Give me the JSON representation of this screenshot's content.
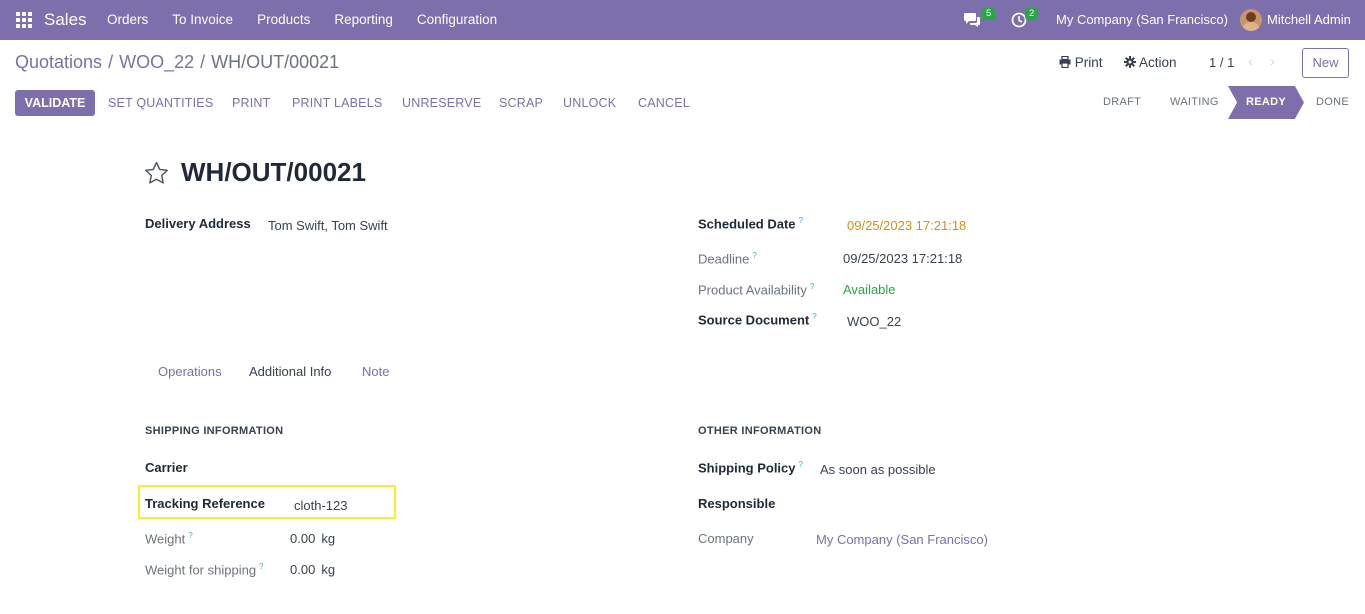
{
  "navbar": {
    "brand": "Sales",
    "menu": [
      "Orders",
      "To Invoice",
      "Products",
      "Reporting",
      "Configuration"
    ],
    "messages_count": "5",
    "activities_count": "2",
    "company": "My Company (San Francisco)",
    "user": "Mitchell Admin"
  },
  "breadcrumb": {
    "items": [
      "Quotations",
      "WOO_22"
    ],
    "current": "WH/OUT/00021"
  },
  "control_panel": {
    "print_label": "Print",
    "action_label": "Action",
    "pager": "1 / 1",
    "new_label": "New"
  },
  "header_buttons": {
    "validate": "VALIDATE",
    "set_quantities": "SET QUANTITIES",
    "print": "PRINT",
    "print_labels": "PRINT LABELS",
    "unreserve": "UNRESERVE",
    "scrap": "SCRAP",
    "unlock": "UNLOCK",
    "cancel": "CANCEL"
  },
  "status": {
    "steps": [
      "DRAFT",
      "WAITING",
      "READY",
      "DONE"
    ],
    "current": "READY"
  },
  "form": {
    "title": "WH/OUT/00021",
    "delivery_address_label": "Delivery Address",
    "delivery_address": "Tom Swift, Tom Swift",
    "scheduled_date_label": "Scheduled Date",
    "scheduled_date": "09/25/2023 17:21:18",
    "deadline_label": "Deadline",
    "deadline": "09/25/2023 17:21:18",
    "availability_label": "Product Availability",
    "availability": "Available",
    "source_document_label": "Source Document",
    "source_document": "WOO_22"
  },
  "tabs": [
    "Operations",
    "Additional Info",
    "Note"
  ],
  "active_tab": "Additional Info",
  "shipping": {
    "section_title": "SHIPPING INFORMATION",
    "carrier_label": "Carrier",
    "tracking_label": "Tracking Reference",
    "tracking_value": "cloth-123",
    "weight_label": "Weight",
    "weight_value": "0.00",
    "weight_unit": "kg",
    "weight_shipping_label": "Weight for shipping",
    "weight_shipping_value": "0.00",
    "weight_shipping_unit": "kg"
  },
  "other": {
    "section_title": "OTHER INFORMATION",
    "shipping_policy_label": "Shipping Policy",
    "shipping_policy": "As soon as possible",
    "responsible_label": "Responsible",
    "company_label": "Company",
    "company": "My Company (San Francisco)"
  },
  "help_mark": "?",
  "colors": {
    "brand": "#7c6fab",
    "badge": "#28a745",
    "highlight": "#f5f02f",
    "scheduled_date": "#d09019",
    "available": "#28a745"
  }
}
